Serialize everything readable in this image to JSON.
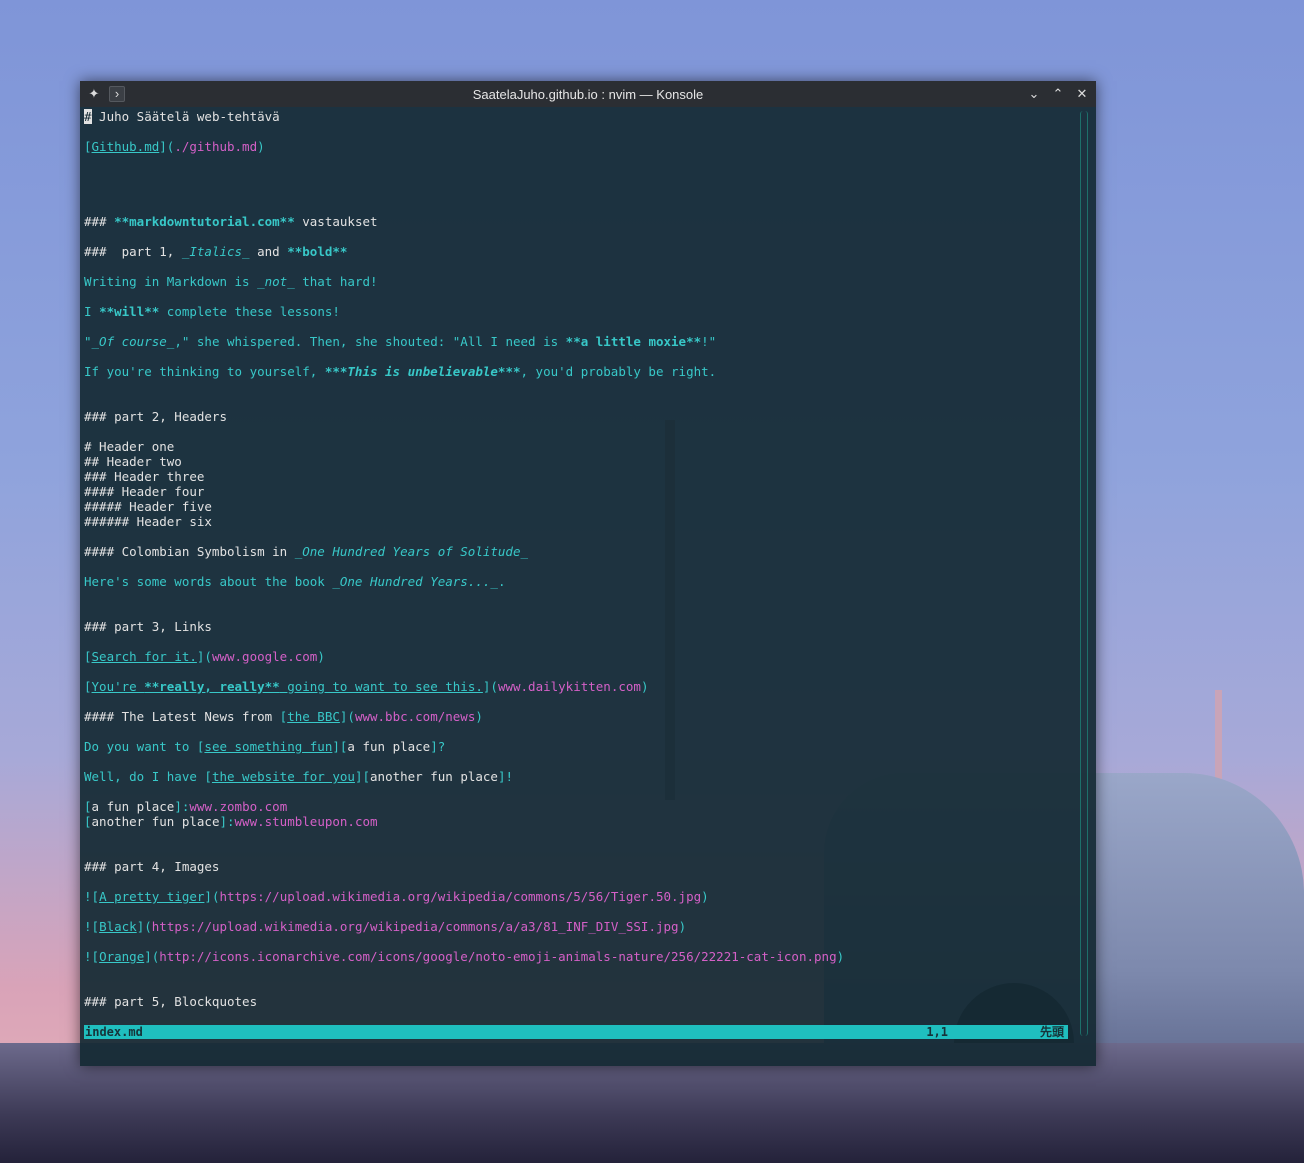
{
  "window": {
    "title": "SaatelaJuho.github.io : nvim — Konsole",
    "pin_icon": "pin-icon",
    "terminal_icon": "terminal-icon",
    "minimize_icon": "chevron-down-icon",
    "maximize_icon": "chevron-up-icon",
    "close_icon": "close-icon"
  },
  "lines": {
    "l1": "# Juho Säätelä web-tehtävä",
    "l1_cursor": "#",
    "l2_a": "[",
    "l2_b": "Github.md",
    "l2_c": "](",
    "l2_d": "./github.md",
    "l2_e": ")",
    "l3_a": "### ",
    "l3_b": "**markdowntutorial.com**",
    "l3_c": " vastaukset",
    "l4_a": "###  part 1, ",
    "l4_b": "_Italics_",
    "l4_c": " and ",
    "l4_d": "**bold**",
    "l5_a": "Writing in Markdown is ",
    "l5_b": "_not_",
    "l5_c": " that hard!",
    "l6_a": "I ",
    "l6_b": "**will**",
    "l6_c": " complete these lessons!",
    "l7_a": "\"",
    "l7_b": "_Of course_",
    "l7_c": ",\" she whispered. Then, she shouted: \"All I need is ",
    "l7_d": "**a little moxie**",
    "l7_e": "!\"",
    "l8_a": "If you're thinking to yourself, ",
    "l8_b": "***This is unbelievable***",
    "l8_c": ", you'd probably be right.",
    "l9": "### part 2, Headers",
    "l10": "# Header one",
    "l11": "## Header two",
    "l12": "### Header three",
    "l13": "#### Header four",
    "l14": "##### Header five",
    "l15": "###### Header six",
    "l16_a": "#### Colombian Symbolism in ",
    "l16_b": "_One Hundred Years of Solitude_",
    "l17_a": "Here's some words about the book ",
    "l17_b": "_One Hundred Years..._",
    "l17_c": ".",
    "l18": "### part 3, Links",
    "l19_a": "[",
    "l19_b": "Search for it.",
    "l19_c": "](",
    "l19_d": "www.google.com",
    "l19_e": ")",
    "l20_a": "[",
    "l20_b": "You're ",
    "l20_c": "**really, really**",
    "l20_d": " going to want to see this.",
    "l20_e": "](",
    "l20_f": "www.dailykitten.com",
    "l20_g": ")",
    "l21_a": "#### The Latest News from ",
    "l21_b": "[",
    "l21_c": "the BBC",
    "l21_d": "](",
    "l21_e": "www.bbc.com/news",
    "l21_f": ")",
    "l22_a": "Do you want to ",
    "l22_b": "[",
    "l22_c": "see something fun",
    "l22_d": "][",
    "l22_e": "a fun place",
    "l22_f": "]?",
    "l23_a": "Well, do I have ",
    "l23_b": "[",
    "l23_c": "the website for you",
    "l23_d": "][",
    "l23_e": "another fun place",
    "l23_f": "]!",
    "l24_a": "[",
    "l24_b": "a fun place",
    "l24_c": "]:",
    "l24_d": "www.zombo.com",
    "l25_a": "[",
    "l25_b": "another fun place",
    "l25_c": "]:",
    "l25_d": "www.stumbleupon.com",
    "l26": "### part 4, Images",
    "l27_a": "![",
    "l27_b": "A pretty tiger",
    "l27_c": "](",
    "l27_d": "https://upload.wikimedia.org/wikipedia/commons/5/56/Tiger.50.jpg",
    "l27_e": ")",
    "l28_a": "![",
    "l28_b": "Black",
    "l28_c": "](",
    "l28_d": "https://upload.wikimedia.org/wikipedia/commons/a/a3/81_INF_DIV_SSI.jpg",
    "l28_e": ")",
    "l29_a": "![",
    "l29_b": "Orange",
    "l29_c": "](",
    "l29_d": "http://icons.iconarchive.com/icons/google/noto-emoji-animals-nature/256/22221-cat-icon.png",
    "l29_e": ")",
    "l30": "### part 5, Blockquotes"
  },
  "status": {
    "filename": "index.md",
    "position": "1,1",
    "scroll": "先頭"
  },
  "colors": {
    "cyan": "#38c8c8",
    "magenta": "#d460c7",
    "status_bg": "#1fbfbf"
  }
}
